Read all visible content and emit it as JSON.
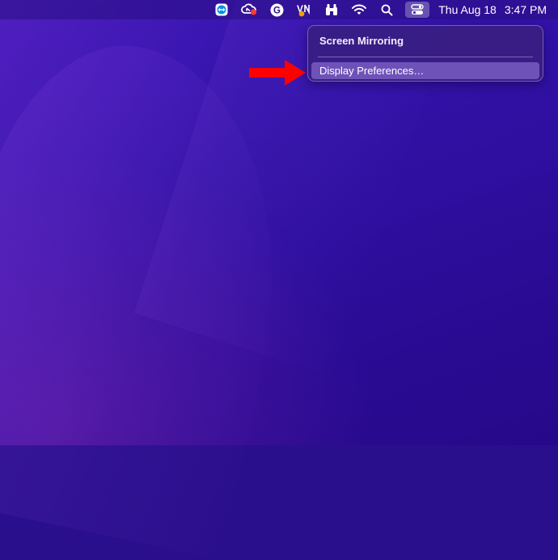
{
  "menubar": {
    "icons": [
      {
        "name": "teamviewer-icon"
      },
      {
        "name": "creative-cloud-icon"
      },
      {
        "name": "grammarly-icon"
      },
      {
        "name": "vnc-icon"
      },
      {
        "name": "binoculars-icon"
      },
      {
        "name": "wifi-icon"
      },
      {
        "name": "spotlight-search-icon"
      },
      {
        "name": "control-center-icon"
      }
    ],
    "date": "Thu Aug 18",
    "time": "3:47 PM",
    "grammarly_glyph": "G",
    "vnc_glyph": "V"
  },
  "dropdown": {
    "title": "Screen Mirroring",
    "items": [
      {
        "label": "Display Preferences…",
        "highlighted": true
      }
    ]
  },
  "annotation": {
    "arrow_color": "#ff0000"
  },
  "colors": {
    "desktop": "#2a0f8c",
    "menu_highlight": "#8264c8"
  }
}
